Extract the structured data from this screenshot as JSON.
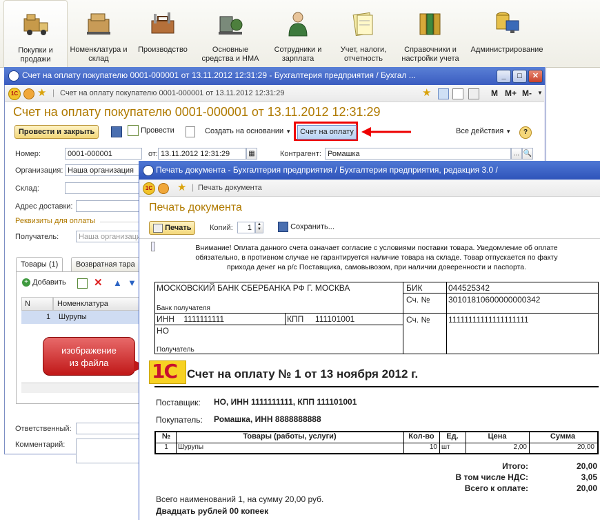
{
  "sections": [
    {
      "label": "Покупки и продажи",
      "icon": "truck-icon",
      "active": true
    },
    {
      "label": "Номенклатура и склад",
      "icon": "boxes-icon"
    },
    {
      "label": "Производство",
      "icon": "toolbox-icon"
    },
    {
      "label": "Основные средства и НМА",
      "icon": "machine-icon"
    },
    {
      "label": "Сотрудники и зарплата",
      "icon": "employee-icon"
    },
    {
      "label": "Учет, налоги, отчетность",
      "icon": "reports-icon"
    },
    {
      "label": "Справочники и настройки учета",
      "icon": "binders-icon"
    },
    {
      "label": "Администрирование",
      "icon": "admin-icon"
    }
  ],
  "invoice_window": {
    "title": "Счет на оплату покупателю 0001-000001 от 13.11.2012 12:31:29 - Бухгалтерия предприятия / Бухгал ...",
    "nav_text": "Счет на оплату покупателю 0001-000001 от 13.11.2012 12:31:29",
    "header": "Счет на оплату покупателю 0001-000001 от 13.11.2012 12:31:29",
    "toolbar": {
      "post_close": "Провести и закрыть",
      "post": "Провести",
      "create_based": "Создать на основании",
      "invoice_button": "Счет на оплату",
      "all_actions": "Все действия",
      "help": "?"
    },
    "nav_right": {
      "m": "M",
      "mplus": "M+",
      "mminus": "M-"
    },
    "fields": {
      "number_label": "Номер:",
      "number_value": "0001-000001",
      "from_label": "от:",
      "date_value": "13.11.2012 12:31:29",
      "contractor_label": "Контрагент:",
      "contractor_value": "Ромашка",
      "org_label": "Организация:",
      "org_value": "Наша организация",
      "warehouse_label": "Склад:",
      "address_label": "Адрес доставки:",
      "payment_req": "Реквизиты для оплаты",
      "recipient_label": "Получатель:",
      "recipient_placeholder": "Наша организаци",
      "responsible_label": "Ответственный:",
      "comment_label": "Комментарий:"
    },
    "tabs": [
      "Товары (1)",
      "Возвратная тара"
    ],
    "add_label": "Добавить",
    "grid": {
      "col_n": "N",
      "col_item": "Номенклатура",
      "rows": [
        {
          "n": "1",
          "item": "Шурупы"
        }
      ]
    }
  },
  "callout": "изображение из файла",
  "print_window": {
    "title": "Печать документа - Бухгалтерия предприятия / Бухгалтерия предприятия, редакция 3.0 /",
    "nav_text": "Печать документа",
    "header": "Печать документа",
    "print_button": "Печать",
    "copies_label": "Копий:",
    "copies_value": "1",
    "save_button": "Сохранить...",
    "notice": [
      "Внимание! Оплата данного счета означает согласие с условиями поставки товара. Уведомление об оплате",
      "обязательно, в противном случае не гарантируется наличие товара на складе. Товар отпускается по факту",
      "прихода денег на р/с Поставщика, самовывозом, при наличии доверенности и паспорта."
    ],
    "bank": {
      "bank_name": "МОСКОВСКИЙ БАНК СБЕРБАНКА РФ Г. МОСКВА",
      "bank_recipient_label": "Банк получателя",
      "bik_label": "БИК",
      "bik_value": "044525342",
      "acc_label": "Сч. №",
      "corr_acc": "30101810600000000342",
      "inn_label": "ИНН",
      "inn_value": "1111111111",
      "kpp_label": "КПП",
      "kpp_value": "111101001",
      "acc2_label": "Сч. №",
      "account": "11111111111111111111",
      "recipient_name": "НО",
      "recipient_label": "Получатель"
    },
    "logo_text": "1С",
    "doc_title": "Счет на оплату № 1 от 13 ноября 2012 г.",
    "supplier_label": "Поставщик:",
    "supplier_value": "НО, ИНН 1111111111, КПП 111101001",
    "buyer_label": "Покупатель:",
    "buyer_value": "Ромашка, ИНН 8888888888",
    "items_header": [
      "№",
      "Товары (работы, услуги)",
      "Кол-во",
      "Ед.",
      "Цена",
      "Сумма"
    ],
    "items": [
      {
        "n": "1",
        "name": "Шурупы",
        "qty": "10",
        "unit": "шт",
        "price": "2,00",
        "sum": "20,00"
      }
    ],
    "totals": [
      {
        "label": "Итого:",
        "value": "20,00"
      },
      {
        "label": "В том числе НДС:",
        "value": "3,05"
      },
      {
        "label": "Всего к оплате:",
        "value": "20,00"
      }
    ],
    "summary": "Всего наименований 1, на сумму 20,00 руб.",
    "amount_words": "Двадцать рублей 00 копеек"
  },
  "colors": {
    "accent_gold": "#b07a00",
    "titlebar": "#3a5cc0",
    "highlight_red": "#e00000"
  }
}
